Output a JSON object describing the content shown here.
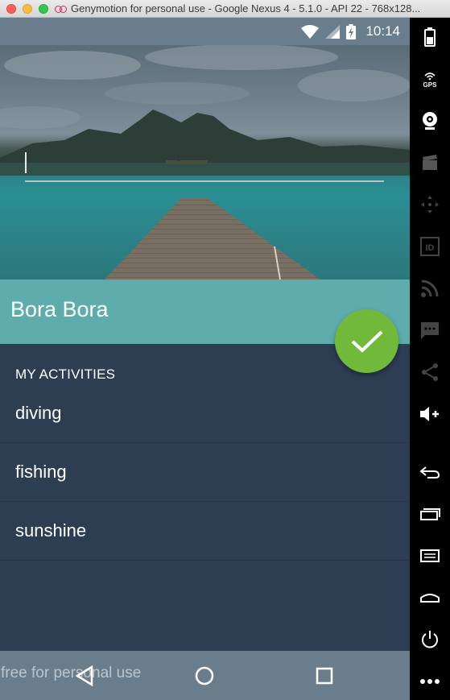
{
  "window": {
    "title": "Genymotion for personal use - Google Nexus 4 - 5.1.0 - API 22 - 768x128..."
  },
  "status_bar": {
    "time": "10:14",
    "icons": [
      "wifi-icon",
      "signal-icon",
      "battery-icon"
    ]
  },
  "hero": {
    "image": "bora-bora-dock-photo",
    "input_value": ""
  },
  "place": {
    "title": "Bora Bora"
  },
  "fab": {
    "icon": "checkmark-icon",
    "color": "#71b93a"
  },
  "activities": {
    "header": "MY ACTIVITIES",
    "items": [
      {
        "label": "diving"
      },
      {
        "label": "fishing"
      },
      {
        "label": "sunshine"
      }
    ]
  },
  "nav_bar": {
    "buttons": [
      "back-icon",
      "home-icon",
      "recents-icon"
    ]
  },
  "watermark": "free for personal use",
  "toolbar": {
    "items": [
      "battery-icon",
      "gps-icon",
      "webcam-icon",
      "clapper-icon",
      "dpad-icon",
      "id-icon",
      "rss-icon",
      "sms-icon",
      "share-icon",
      "volume-up-icon",
      "back-icon",
      "recents-icon",
      "menu-icon",
      "home-icon",
      "power-icon",
      "more-icon"
    ]
  },
  "colors": {
    "primary": "#5eacac",
    "background": "#2d3e53",
    "status_bar": "#6a7d8c",
    "accent": "#71b93a"
  }
}
